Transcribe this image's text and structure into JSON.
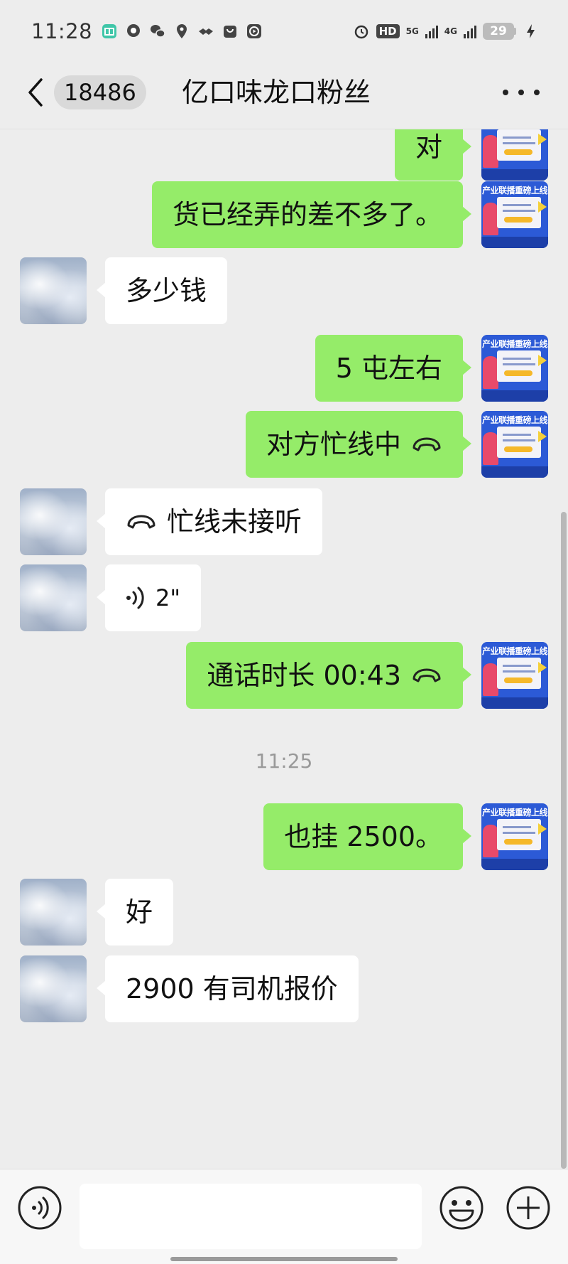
{
  "status_bar": {
    "time": "11:28",
    "hd": "HD",
    "net1": "5G",
    "net2": "4G",
    "battery": "29"
  },
  "nav": {
    "unread_count": "18486",
    "title": "亿口味龙口粉丝"
  },
  "promo_avatar": {
    "title": "产业联播重磅上线"
  },
  "messages": [
    {
      "side": "right",
      "text": "对"
    },
    {
      "side": "right",
      "text": "货已经弄的差不多了。"
    },
    {
      "side": "left",
      "text": "多少钱"
    },
    {
      "side": "right",
      "text": "5 屯左右"
    },
    {
      "side": "right",
      "text": "对方忙线中",
      "icon": "hangup-phone-icon"
    },
    {
      "side": "left",
      "text": "忙线未接听",
      "icon": "hangup-phone-icon"
    },
    {
      "side": "left",
      "text": "2\"",
      "icon": "voice-wave-icon"
    },
    {
      "side": "right",
      "text": "通话时长 00:43",
      "icon": "hangup-phone-icon"
    },
    {
      "type": "time",
      "text": "11:25"
    },
    {
      "side": "right",
      "text": "也挂 2500。"
    },
    {
      "side": "left",
      "text": "好"
    },
    {
      "side": "left",
      "text": "2900 有司机报价"
    }
  ],
  "input_bar": {
    "placeholder": ""
  },
  "colors": {
    "self_bubble": "#95ec69",
    "other_bubble": "#ffffff",
    "background": "#ededed"
  }
}
